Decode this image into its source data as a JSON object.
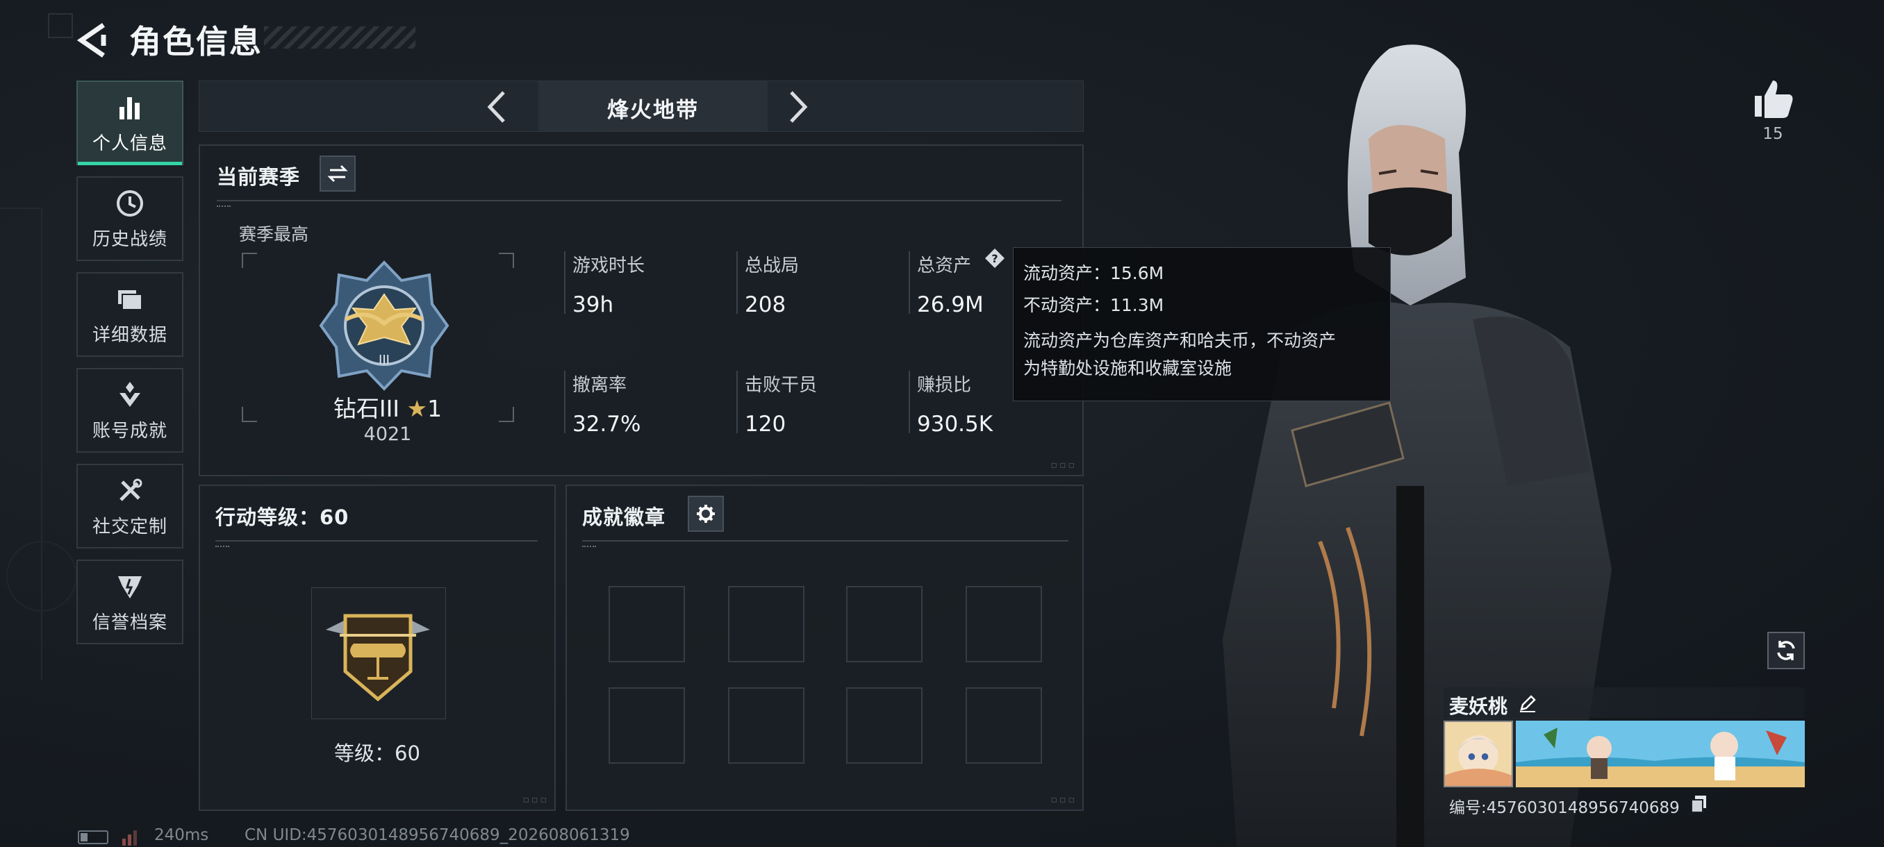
{
  "header": {
    "title": "角色信息",
    "back_icon": "back-arrow-icon"
  },
  "nav": {
    "items": [
      {
        "label": "个人信息",
        "icon": "bar-chart-icon",
        "active": true
      },
      {
        "label": "历史战绩",
        "icon": "clock-icon",
        "active": false
      },
      {
        "label": "详细数据",
        "icon": "folder-icon",
        "active": false
      },
      {
        "label": "账号成就",
        "icon": "achievement-icon",
        "active": false
      },
      {
        "label": "社交定制",
        "icon": "tools-icon",
        "active": false
      },
      {
        "label": "信誉档案",
        "icon": "shield-icon",
        "active": false
      }
    ]
  },
  "mode": {
    "label": "烽火地带"
  },
  "season": {
    "title": "当前赛季",
    "best_label": "赛季最高",
    "rank_name": "钻石III",
    "rank_stars": "1",
    "rank_score": "4021",
    "stats": [
      {
        "label": "游戏时长",
        "value": "39h"
      },
      {
        "label": "总战局",
        "value": "208"
      },
      {
        "label": "总资产",
        "value": "26.9M"
      },
      {
        "label": "撤离率",
        "value": "32.7%"
      },
      {
        "label": "击败干员",
        "value": "120"
      },
      {
        "label": "赚损比",
        "value": "930.5K"
      }
    ]
  },
  "tooltip": {
    "liquid": "流动资产：15.6M",
    "fixed": "不动资产：11.3M",
    "desc_1": "流动资产为仓库资产和哈夫币，不动资产",
    "desc_2": "为特勤处设施和收藏室设施"
  },
  "action": {
    "title": "行动等级：60",
    "level_text": "等级：60",
    "level": 60
  },
  "achievements": {
    "title": "成就徽章",
    "slots": 8
  },
  "profile": {
    "likes": "15",
    "name": "麦妖桃",
    "id_text": "编号:4576030148956740689"
  },
  "footer": {
    "ping": "240ms",
    "uid": "CN UID:4576030148956740689_202608061319"
  },
  "colors": {
    "accent": "#36d3a4",
    "panel_bg": "#1a1f25",
    "border": "#323941",
    "gold": "#d9b45a"
  }
}
